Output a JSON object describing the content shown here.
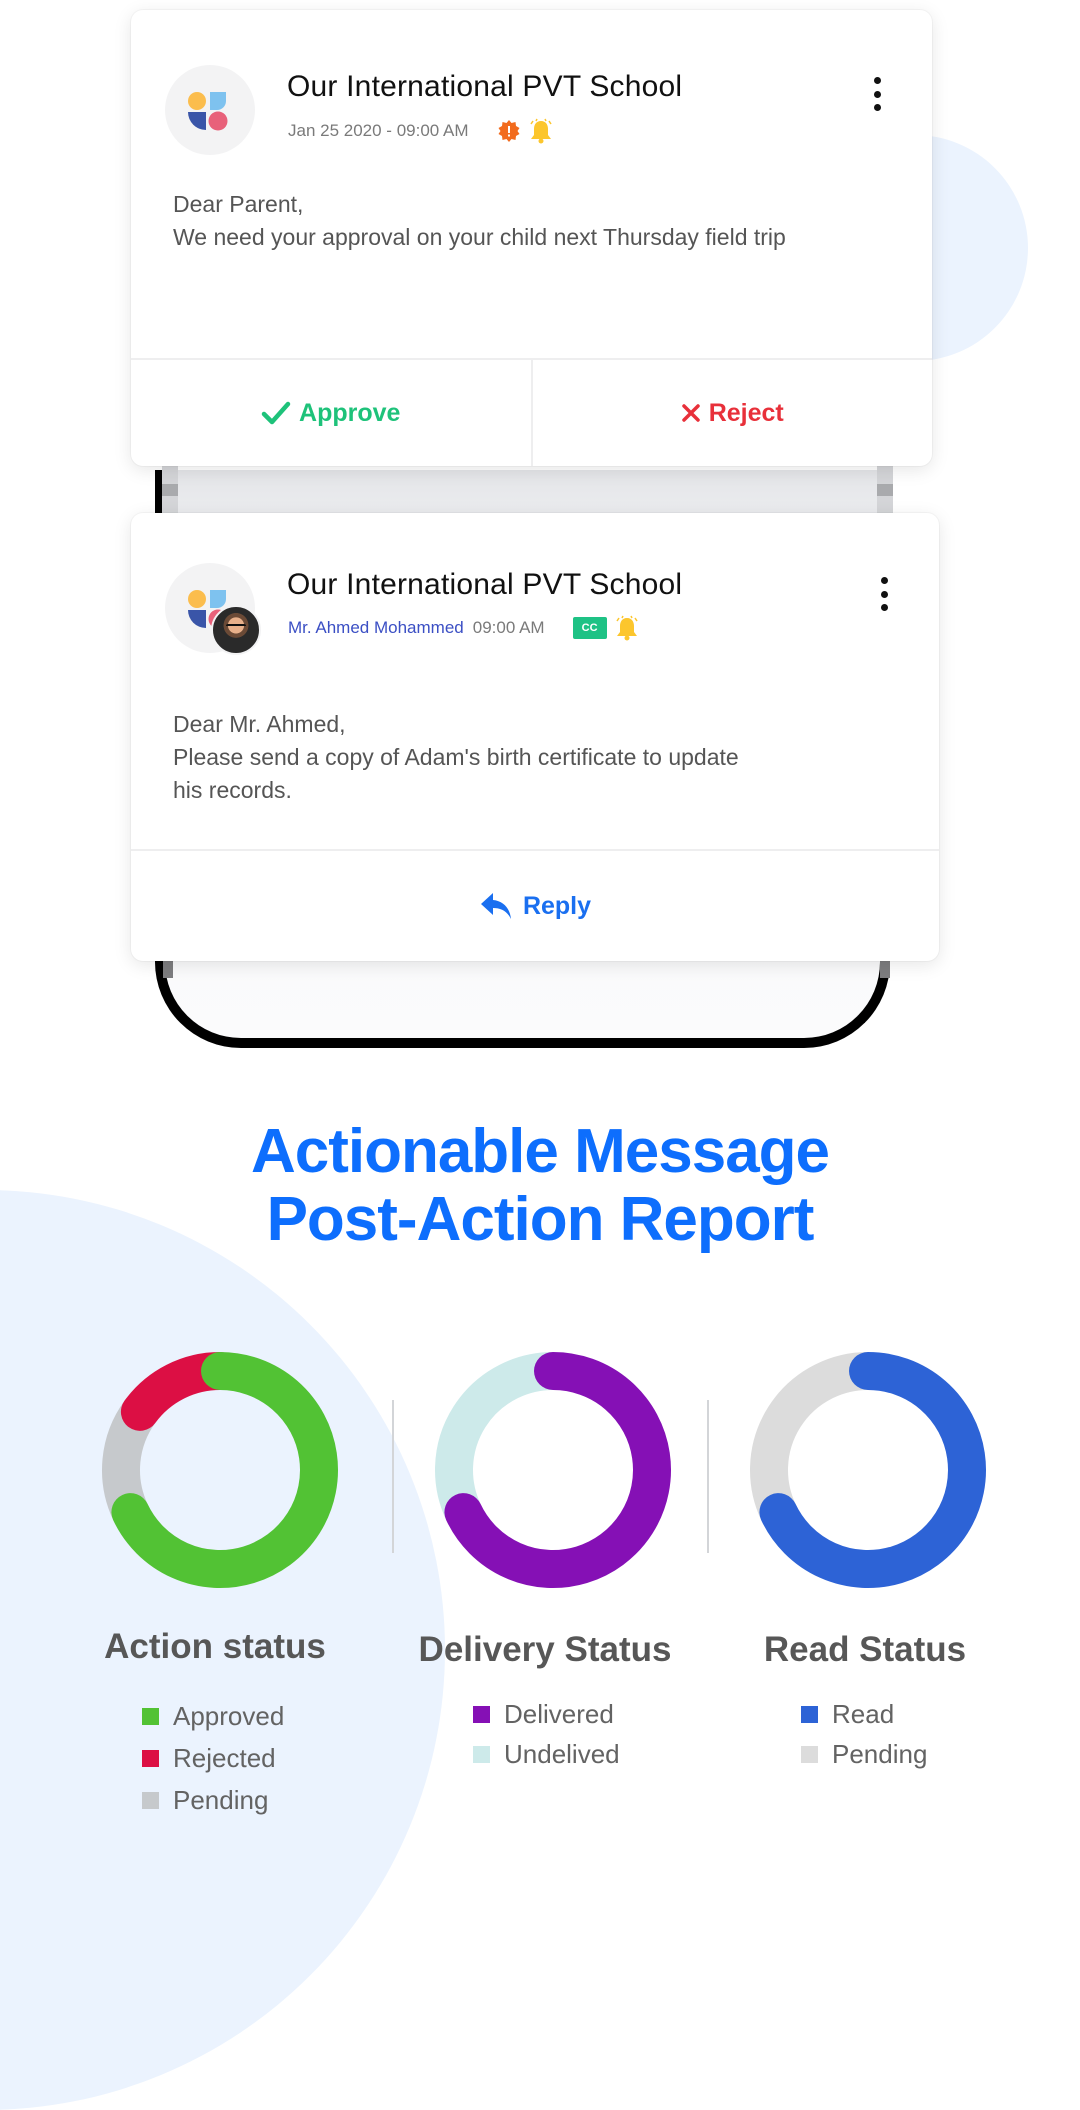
{
  "messages": [
    {
      "title": "Our International PVT School",
      "meta_time": "Jan 25 2020 - 09:00 AM",
      "badges": [
        "important-badge-icon",
        "bell-icon"
      ],
      "body_lines": [
        "Dear Parent,",
        "We need  your approval on your child next Thursday field trip"
      ],
      "actions": [
        {
          "label": "Approve",
          "icon": "check-icon",
          "color": "#1ec27a"
        },
        {
          "label": "Reject",
          "icon": "close-icon",
          "color": "#e8303a"
        }
      ]
    },
    {
      "title": "Our International PVT School",
      "sender": "Mr. Ahmed Mohammed",
      "meta_time": "09:00 AM",
      "cc_label": "CC",
      "badges": [
        "cc-badge",
        "bell-icon"
      ],
      "body_lines": [
        "Dear Mr. Ahmed,",
        "Please send a copy of Adam's birth certificate to update",
        "his records."
      ],
      "actions": [
        {
          "label": "Reply",
          "icon": "reply-icon",
          "color": "#1a6ff0"
        }
      ]
    }
  ],
  "headline": {
    "line1": "Actionable Message",
    "line2": "Post-Action Report",
    "color": "#0d6efd"
  },
  "chart_data": [
    {
      "type": "pie",
      "variant": "donut",
      "title": "Action status",
      "categories": [
        "Approved",
        "Rejected",
        "Pending"
      ],
      "values": [
        68,
        15,
        17
      ],
      "unit": "%",
      "colors": [
        "#52c234",
        "#dc0f44",
        "#c6c9cc"
      ],
      "start": "top",
      "direction": "clockwise",
      "segment_order": [
        "Approved",
        "Pending",
        "Rejected"
      ],
      "legend": "below"
    },
    {
      "type": "pie",
      "variant": "donut",
      "title": "Delivery Status",
      "categories": [
        "Delivered",
        "Undelived"
      ],
      "values": [
        68,
        32
      ],
      "unit": "%",
      "colors": [
        "#8510b5",
        "#cdeaea"
      ],
      "start": "top",
      "direction": "clockwise",
      "segment_order": [
        "Delivered",
        "Undelived"
      ],
      "legend": "below"
    },
    {
      "type": "pie",
      "variant": "donut",
      "title": "Read Status",
      "categories": [
        "Read",
        "Pending"
      ],
      "values": [
        68,
        32
      ],
      "unit": "%",
      "colors": [
        "#2d63d6",
        "#dcdcdc"
      ],
      "start": "top",
      "direction": "clockwise",
      "segment_order": [
        "Read",
        "Pending"
      ],
      "legend": "below"
    }
  ]
}
